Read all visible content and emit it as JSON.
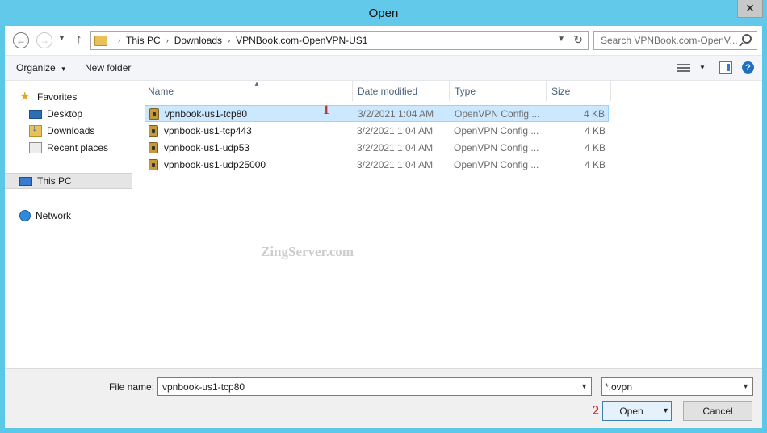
{
  "window": {
    "title": "Open",
    "close_glyph": "✕"
  },
  "nav": {
    "back_glyph": "←",
    "forward_glyph": "→",
    "recent_glyph": "▼",
    "up_glyph": "↑"
  },
  "address": {
    "breadcrumb": [
      "This PC",
      "Downloads",
      "VPNBook.com-OpenVPN-US1"
    ],
    "separator": "›",
    "dropdown_glyph": "▼",
    "refresh_glyph": "↻"
  },
  "search": {
    "placeholder": "Search VPNBook.com-OpenV..."
  },
  "toolbar": {
    "organize_label": "Organize",
    "organize_caret": "▼",
    "new_folder_label": "New folder",
    "views_caret": "▼",
    "help_glyph": "?"
  },
  "sidebar": {
    "items": [
      {
        "label": "Favorites",
        "icon": "star-icon"
      },
      {
        "label": "Desktop",
        "icon": "desktop-icon"
      },
      {
        "label": "Downloads",
        "icon": "downloads-folder-icon"
      },
      {
        "label": "Recent places",
        "icon": "recent-places-icon"
      },
      {
        "label": "This PC",
        "icon": "computer-icon",
        "selected": true
      },
      {
        "label": "Network",
        "icon": "network-icon"
      }
    ]
  },
  "files": {
    "columns": [
      "Name",
      "Date modified",
      "Type",
      "Size"
    ],
    "sort_glyph": "▲",
    "rows": [
      {
        "name": "vpnbook-us1-tcp80",
        "date": "3/2/2021 1:04 AM",
        "type": "OpenVPN Config ...",
        "size": "4 KB",
        "selected": true
      },
      {
        "name": "vpnbook-us1-tcp443",
        "date": "3/2/2021 1:04 AM",
        "type": "OpenVPN Config ...",
        "size": "4 KB"
      },
      {
        "name": "vpnbook-us1-udp53",
        "date": "3/2/2021 1:04 AM",
        "type": "OpenVPN Config ...",
        "size": "4 KB"
      },
      {
        "name": "vpnbook-us1-udp25000",
        "date": "3/2/2021 1:04 AM",
        "type": "OpenVPN Config ...",
        "size": "4 KB"
      }
    ]
  },
  "annotations": {
    "step1": "1",
    "step2": "2",
    "watermark": "ZingServer.com"
  },
  "footer": {
    "file_name_label": "File name:",
    "file_name_value": "vpnbook-us1-tcp80",
    "filter_value": "*.ovpn",
    "dropdown_glyph": "▼",
    "open_label": "Open",
    "cancel_label": "Cancel"
  },
  "colors": {
    "titlebar": "#63c9ea",
    "selection": "#cce8ff",
    "accent": "#3c7fb1",
    "marker": "#c0312b"
  }
}
